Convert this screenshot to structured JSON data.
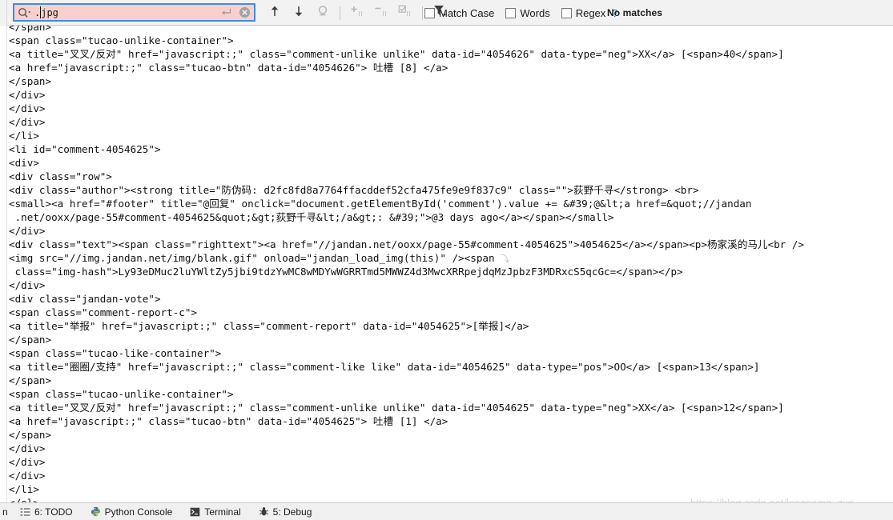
{
  "find_toolbar": {
    "search_input": {
      "value": ".jpg",
      "prefix_dot": ".",
      "after_caret": "jpg",
      "magnifier_icon": "search-icon",
      "dropdown_icon": "chevron-down-icon",
      "enter_icon": "return-arrow-icon",
      "clear_icon": "clear-circle-icon",
      "background_color": "#fbcfcb",
      "focus_border_color": "#3d8ee0"
    },
    "buttons": [
      {
        "name": "find-previous",
        "icon": "arrow-up-icon",
        "enabled": true
      },
      {
        "name": "find-next",
        "icon": "arrow-down-icon",
        "enabled": true
      },
      {
        "name": "find-all",
        "icon": "magnifier-multi-icon",
        "enabled": false
      },
      {
        "name": "add-selection-next-occurrence",
        "icon": "plus-selection-icon",
        "enabled": false
      },
      {
        "name": "remove-selection-occurrence",
        "icon": "minus-selection-icon",
        "enabled": false
      },
      {
        "name": "select-all-occurrences",
        "icon": "check-selection-icon",
        "enabled": false
      },
      {
        "name": "filter",
        "icon": "filter-funnel-icon",
        "enabled": true
      }
    ],
    "options": [
      {
        "label": "Match Case",
        "mnemonic": "C",
        "checked": false
      },
      {
        "label": "Words",
        "mnemonic": "o",
        "checked": false
      },
      {
        "label": "Regex",
        "mnemonic": "x",
        "checked": false
      }
    ],
    "help_label": "?",
    "status_message": "No matches"
  },
  "editor": {
    "lines": [
      "</span>",
      "<span class=\"tucao-unlike-container\">",
      "<a title=\"叉叉/反对\" href=\"javascript:;\" class=\"comment-unlike unlike\" data-id=\"4054626\" data-type=\"neg\">XX</a> [<span>40</span>]",
      "<a href=\"javascript:;\" class=\"tucao-btn\" data-id=\"4054626\"> 吐槽 [8] </a>",
      "</span>",
      "</div>",
      "</div>",
      "</div>",
      "</li>",
      "<li id=\"comment-4054625\">",
      "<div>",
      "<div class=\"row\">",
      "<div class=\"author\"><strong title=\"防伪码: d2fc8fd8a7764ffacddef52cfa475fe9e9f837c9\" class=\"\">荻野千寻</strong> <br>",
      "<small><a href=\"#footer\" title=\"@回复\" onclick=\"document.getElementById('comment').value += &#39;@&lt;a href=&quot;//jandan",
      " .net/ooxx/page-55#comment-4054625&quot;&gt;荻野千寻&lt;/a&gt;: &#39;\">@3 days ago</a></span></small>",
      "</div>",
      "<div class=\"text\"><span class=\"righttext\"><a href=\"//jandan.net/ooxx/page-55#comment-4054625\">4054625</a></span><p>杨家溪的马儿<br />",
      "<img src=\"//img.jandan.net/img/blank.gif\" onload=\"jandan_load_img(this)\" /><span ",
      " class=\"img-hash\">Ly93eDMuc2luYWltZy5jbi9tdzYwMC8wMDYwWGRRTmd5MWWZ4d3MwcXRRpejdqMzJpbzF3MDRxcS5qcGc=</span></p>",
      "</div>",
      "<div class=\"jandan-vote\">",
      "<span class=\"comment-report-c\">",
      "<a title=\"举报\" href=\"javascript:;\" class=\"comment-report\" data-id=\"4054625\">[举报]</a>",
      "</span>",
      "<span class=\"tucao-like-container\">",
      "<a title=\"圈圈/支持\" href=\"javascript:;\" class=\"comment-like like\" data-id=\"4054625\" data-type=\"pos\">OO</a> [<span>13</span>]",
      "</span>",
      "<span class=\"tucao-unlike-container\">",
      "<a title=\"叉叉/反对\" href=\"javascript:;\" class=\"comment-unlike unlike\" data-id=\"4054625\" data-type=\"neg\">XX</a> [<span>12</span>]",
      "<a href=\"javascript:;\" class=\"tucao-btn\" data-id=\"4054625\"> 吐槽 [1] </a>",
      "</span>",
      "</div>",
      "</div>",
      "</div>",
      "</li>",
      "</ol>"
    ],
    "wrap_indicator_lines": [
      17
    ],
    "img_hash_line_prefix": " class=\"img-hash\">",
    "img_hash_value": "Ly93eDMuc2luYWltZy5jbi9tdzYwMC8wMDYwWGRRTmd5MWWZ4d3MwcXRRpejdqMzJpbzF3MDRxcS5qcGc="
  },
  "watermark": {
    "text": "https://blog.csdn.net/lonesome_zxq"
  },
  "status_bar": {
    "left_fragment": "n",
    "items": [
      {
        "label": "6: TODO",
        "mnemonic": "6",
        "rest": ": TODO",
        "icon": "todo-list-icon"
      },
      {
        "label": "Python Console",
        "mnemonic": "",
        "rest": "Python Console",
        "icon": "python-icon"
      },
      {
        "label": "Terminal",
        "mnemonic": "",
        "rest": "Terminal",
        "icon": "terminal-icon"
      },
      {
        "label": "5: Debug",
        "mnemonic": "5",
        "rest": ": Debug",
        "icon": "bug-icon"
      }
    ]
  }
}
